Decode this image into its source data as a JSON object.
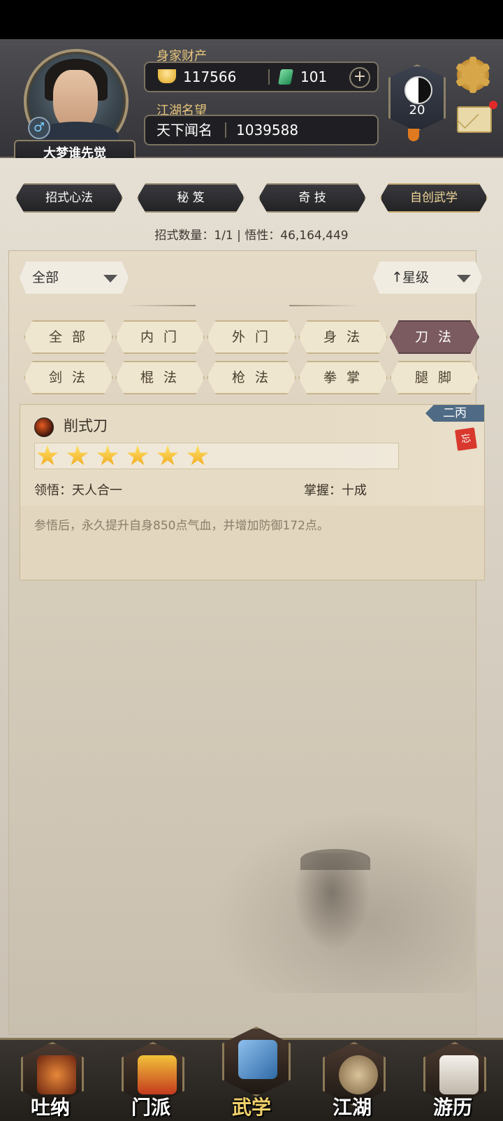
{
  "header": {
    "wealth_label": "身家财产",
    "gold": "117566",
    "jade": "101",
    "reputation_label": "江湖名望",
    "reputation_title": "天下闻名",
    "reputation_value": "1039588",
    "player_name": "大梦谁先觉",
    "gender_symbol": "♂",
    "level": "20"
  },
  "tabs": [
    "招式心法",
    "秘 笈",
    "奇 技",
    "自创武学"
  ],
  "stats": "招式数量：1/1 | 悟性：46,164,449",
  "filters": {
    "left_dropdown": "全部",
    "sort_arrow": "↑",
    "sort_dropdown": "星级",
    "categories": [
      "全 部",
      "内 门",
      "外 门",
      "身 法",
      "刀 法",
      "剑 法",
      "棍 法",
      "枪 法",
      "拳 掌",
      "腿 脚"
    ],
    "active_category": "刀 法"
  },
  "skill_card": {
    "name": "削式刀",
    "rank": "二丙",
    "forget_icon_text": "忘",
    "stars": 6,
    "comprehension": "领悟：天人合一",
    "mastery": "掌握：十成",
    "description": "参悟后，永久提升自身850点气血，并增加防御172点。"
  },
  "bottom_nav": [
    "吐纳",
    "门派",
    "武学",
    "江湖",
    "游历"
  ],
  "colors": {
    "accent_gold": "#e8c67a",
    "active_filter": "#7b5b60",
    "rank_tag": "#4f6a84"
  }
}
